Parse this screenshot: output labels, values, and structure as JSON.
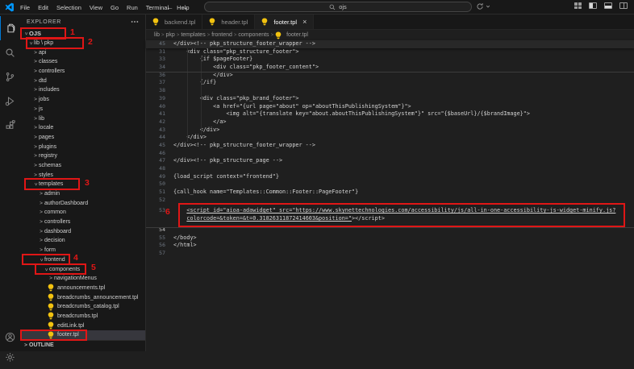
{
  "title_bar": {
    "menus": [
      "File",
      "Edit",
      "Selection",
      "View",
      "Go",
      "Run",
      "Terminal",
      "Help"
    ],
    "search_value": "ojs"
  },
  "tabs": [
    {
      "label": "backend.tpl"
    },
    {
      "label": "header.tpl"
    },
    {
      "label": "footer.tpl"
    }
  ],
  "breadcrumb": [
    "lib",
    "pkp",
    "templates",
    "frontend",
    "components",
    "footer.tpl"
  ],
  "explorer": {
    "header": "EXPLORER",
    "root_label": "OJS",
    "libpkp_label": "lib \\ pkp",
    "outline_label": "OUTLINE",
    "tree": [
      {
        "label": "api"
      },
      {
        "label": "classes"
      },
      {
        "label": "controllers"
      },
      {
        "label": "dtd"
      },
      {
        "label": "includes"
      },
      {
        "label": "jobs"
      },
      {
        "label": "js"
      },
      {
        "label": "lib"
      },
      {
        "label": "locale"
      },
      {
        "label": "pages"
      },
      {
        "label": "plugins"
      },
      {
        "label": "registry"
      },
      {
        "label": "schemas"
      },
      {
        "label": "styles"
      },
      {
        "label": "templates"
      },
      {
        "label": "admin"
      },
      {
        "label": "authorDashboard"
      },
      {
        "label": "common"
      },
      {
        "label": "controllers"
      },
      {
        "label": "dashboard"
      },
      {
        "label": "decision"
      },
      {
        "label": "form"
      },
      {
        "label": "frontend"
      },
      {
        "label": "components"
      },
      {
        "label": "navigationMenus"
      },
      {
        "label": "announcements.tpl"
      },
      {
        "label": "breadcrumbs_announcement.tpl"
      },
      {
        "label": "breadcrumbs_catalog.tpl"
      },
      {
        "label": "breadcrumbs.tpl"
      },
      {
        "label": "editLink.tpl"
      },
      {
        "label": "footer.tpl"
      }
    ]
  },
  "editor": {
    "rows": [
      {
        "num": "45",
        "text": "</div><!-- pkp_structure_footer_wrapper -->"
      },
      {
        "num": "31",
        "text": "    <div class=\"pkp_structure_footer\">"
      },
      {
        "num": "33",
        "text": "        {if $pageFooter}"
      },
      {
        "num": "34",
        "text": "            <div class=\"pkp_footer_content\">"
      },
      {
        "num": "36",
        "text": "            </div>"
      },
      {
        "num": "37",
        "text": "        {/if}"
      },
      {
        "num": "38",
        "text": ""
      },
      {
        "num": "39",
        "text": "        <div class=\"pkp_brand_footer\">"
      },
      {
        "num": "40",
        "text": "            <a href=\"{url page=\"about\" op=\"aboutThisPublishingSystem\"}\">"
      },
      {
        "num": "41",
        "text": "                <img alt=\"{translate key=\"about.aboutThisPublishingSystem\"}\" src=\"{$baseUrl}/{$brandImage}\">"
      },
      {
        "num": "42",
        "text": "            </a>"
      },
      {
        "num": "43",
        "text": "        </div>"
      },
      {
        "num": "44",
        "text": "    </div>"
      },
      {
        "num": "45",
        "text": "</div><!-- pkp_structure_footer_wrapper -->"
      },
      {
        "num": "46",
        "text": ""
      },
      {
        "num": "47",
        "text": "</div><!-- pkp_structure_page -->"
      },
      {
        "num": "48",
        "text": ""
      },
      {
        "num": "49",
        "text": "{load_script context=\"frontend\"}"
      },
      {
        "num": "50",
        "text": ""
      },
      {
        "num": "51",
        "text": "{call_hook name=\"Templates::Common::Footer::PageFooter\"}"
      },
      {
        "num": "52",
        "text": ""
      },
      {
        "num": "53",
        "indent": "    ",
        "text_u": "<script id=\"aioa-adawidget\" src=\"https://www.skynettechnologies.com/accessibility/js/all-in-one-accessibility-js-widget-minify.js?"
      },
      {
        "num": "",
        "indent": "    ",
        "text_u": "colorcode=&token=&t=0.31826311872414603&position=\"",
        "text_plain": "></script>"
      },
      {
        "num": "54",
        "text": ""
      },
      {
        "num": "55",
        "text": "</body>"
      },
      {
        "num": "56",
        "text": "</html>"
      },
      {
        "num": "57",
        "text": ""
      }
    ]
  },
  "annotations": {
    "n1": "1",
    "n2": "2",
    "n3": "3",
    "n4": "4",
    "n5": "5",
    "n6": "6",
    "box_color": "#e01616"
  }
}
